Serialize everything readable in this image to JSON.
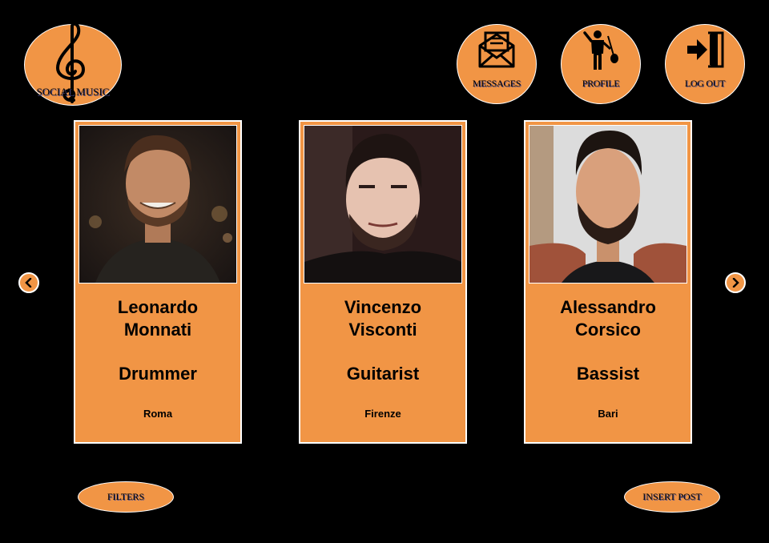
{
  "header": {
    "logo_text": "SOCIAL MUSIC",
    "nav": [
      {
        "label": "MESSAGES",
        "icon": "envelope-icon"
      },
      {
        "label": "PROFILE",
        "icon": "musician-icon"
      },
      {
        "label": "LOG OUT",
        "icon": "logout-door-icon"
      }
    ]
  },
  "cards": [
    {
      "first": "Leonardo",
      "last": "Monnati",
      "role": "Drummer",
      "city": "Roma"
    },
    {
      "first": "Vincenzo",
      "last": "Visconti",
      "role": "Guitarist",
      "city": "Firenze"
    },
    {
      "first": "Alessandro",
      "last": "Corsico",
      "role": "Bassist",
      "city": "Bari"
    }
  ],
  "footer": {
    "filters_label": "FILTERS",
    "insert_label": "INSERT POST"
  },
  "colors": {
    "background": "#000000",
    "accent": "#f19545",
    "border": "#ffffff"
  }
}
